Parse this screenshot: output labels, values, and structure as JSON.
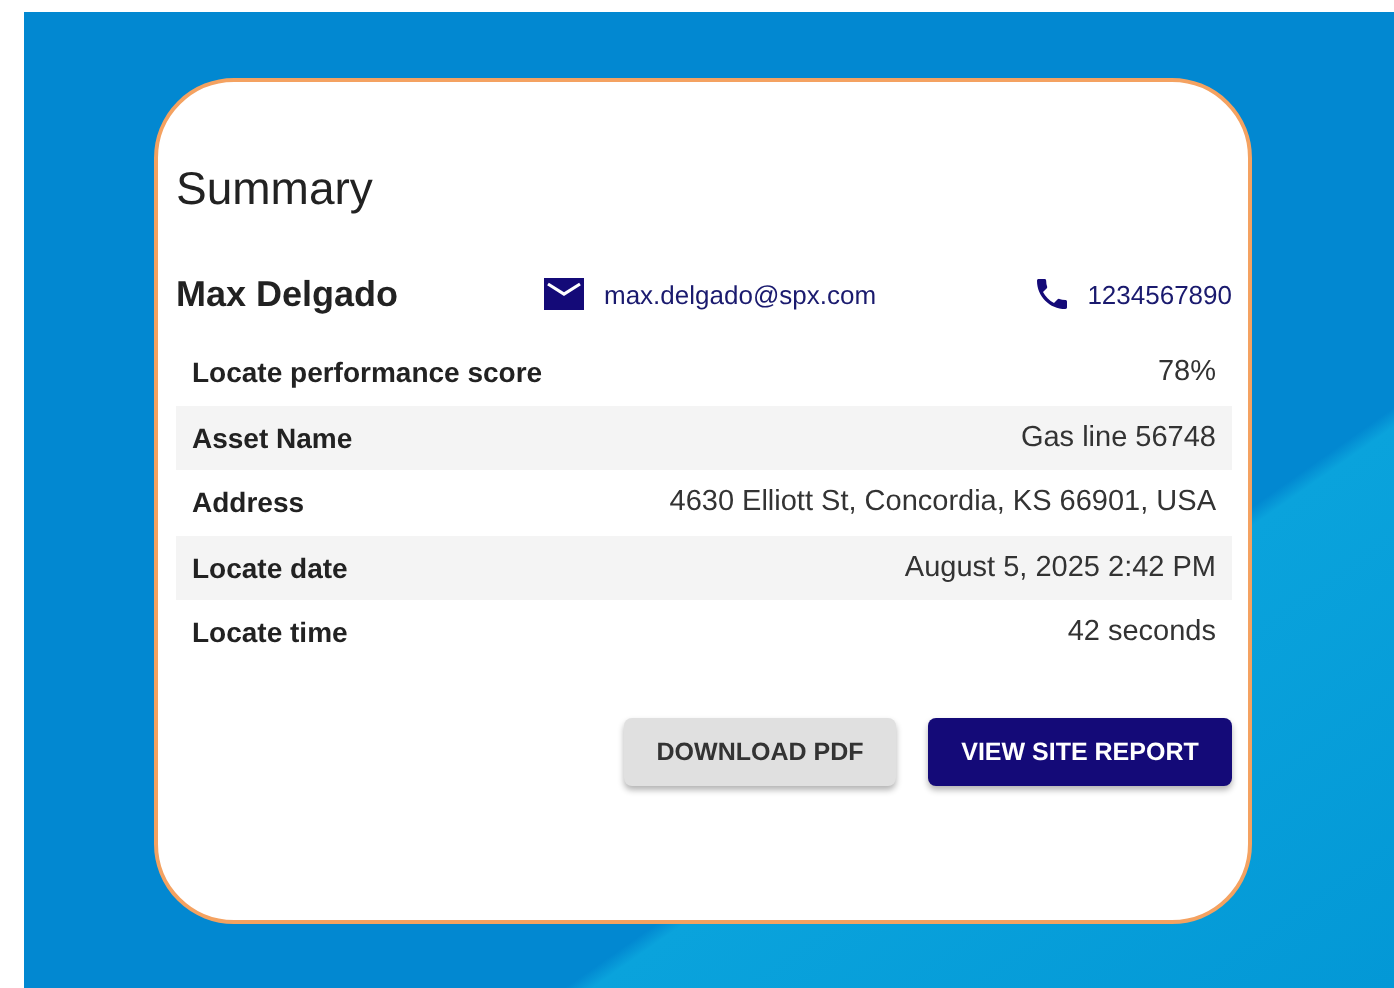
{
  "card": {
    "title": "Summary",
    "contact": {
      "name": "Max Delgado",
      "email": "max.delgado@spx.com",
      "phone": "1234567890"
    },
    "rows": [
      {
        "label": "Locate performance score",
        "value": "78%"
      },
      {
        "label": "Asset Name",
        "value": "Gas line 56748"
      },
      {
        "label": "Address",
        "value": "4630 Elliott St, Concordia, KS 66901, USA"
      },
      {
        "label": "Locate date",
        "value": "August 5, 2025 2:42 PM"
      },
      {
        "label": "Locate time",
        "value": "42 seconds"
      }
    ],
    "buttons": [
      {
        "label": "DOWNLOAD PDF",
        "kind": "secondary"
      },
      {
        "label": "VIEW SITE REPORT",
        "kind": "primary"
      }
    ]
  }
}
